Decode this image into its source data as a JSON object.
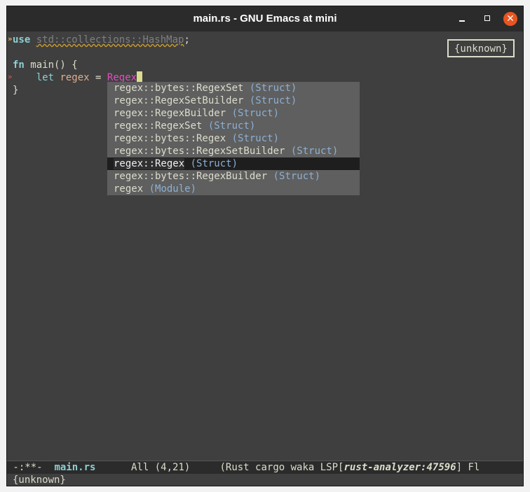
{
  "window": {
    "title": "main.rs - GNU Emacs at mini",
    "close_glyph": "✕"
  },
  "code": {
    "line1": {
      "kw": "use",
      "path": "std::collections::HashMap",
      "semi": ";"
    },
    "line3": {
      "fn": "fn",
      "rest": " main() {"
    },
    "line4": {
      "indent": "    ",
      "let": "let",
      "var": "regex",
      "eq": " = ",
      "typed": "Regex"
    },
    "line5": {
      "brace": "}"
    }
  },
  "fringe": {
    "warning_glyph": "»",
    "error_glyph": "»"
  },
  "badge": {
    "text": "{unknown}"
  },
  "completion": {
    "items": [
      {
        "name": "regex::bytes::RegexSet",
        "annotation": "(Struct)",
        "selected": false
      },
      {
        "name": "regex::RegexSetBuilder",
        "annotation": "(Struct)",
        "selected": false
      },
      {
        "name": "regex::RegexBuilder",
        "annotation": "(Struct)",
        "selected": false
      },
      {
        "name": "regex::RegexSet",
        "annotation": "(Struct)",
        "selected": false
      },
      {
        "name": "regex::bytes::Regex",
        "annotation": "(Struct)",
        "selected": false
      },
      {
        "name": "regex::bytes::RegexSetBuilder",
        "annotation": "(Struct)",
        "selected": false
      },
      {
        "name": "regex::Regex",
        "annotation": "(Struct)",
        "selected": true
      },
      {
        "name": "regex::bytes::RegexBuilder",
        "annotation": "(Struct)",
        "selected": false
      },
      {
        "name": "regex",
        "annotation": "(Module)",
        "selected": false
      }
    ]
  },
  "modeline": {
    "status": " -:**-  ",
    "buffer": "main.rs",
    "position": "      All (4,21)     ",
    "modes_prefix": "(Rust cargo waka LSP[",
    "server": "rust-analyzer:47596",
    "modes_suffix": "] Fl"
  },
  "minibuffer": {
    "text": "{unknown}"
  },
  "colors": {
    "background": "#3f3f3f",
    "error_underline": "#e34dc2",
    "selected_item_bg": "#1e1e1e",
    "close_button": "#e95420"
  }
}
